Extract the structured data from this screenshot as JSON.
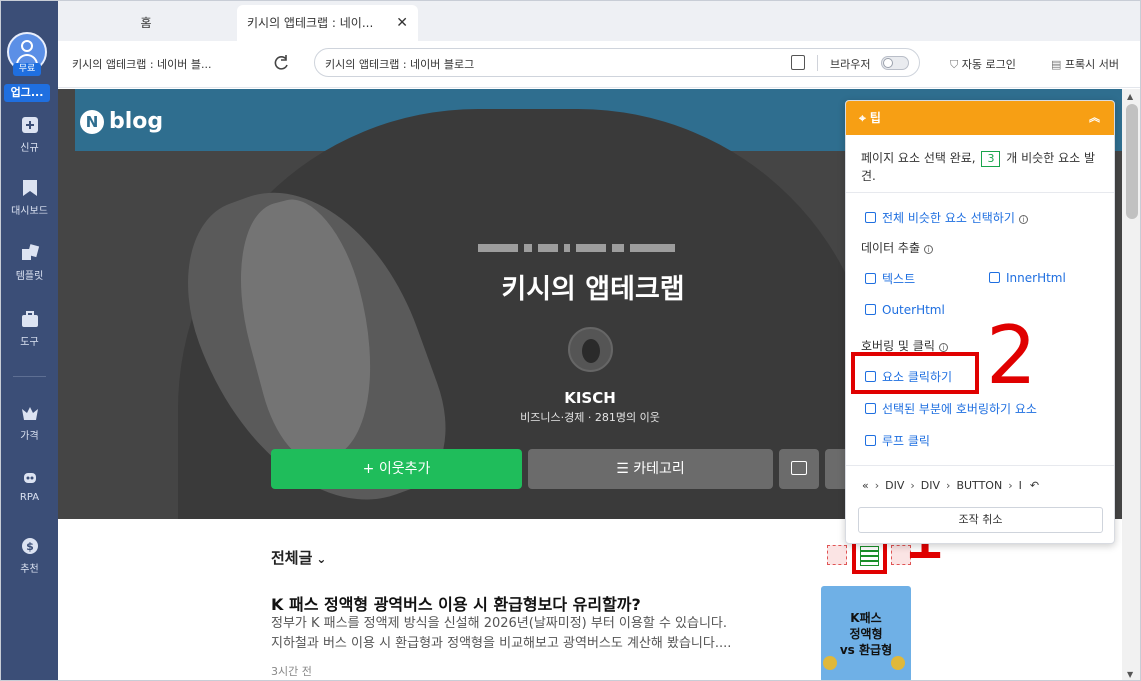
{
  "sidebar": {
    "free_badge": "무료",
    "upgrade_label": "업그...",
    "items": [
      {
        "label": "신규",
        "icon": "plus-square-icon"
      },
      {
        "label": "대시보드",
        "icon": "bookmark-icon"
      },
      {
        "label": "템플릿",
        "icon": "template-icon"
      },
      {
        "label": "도구",
        "icon": "toolbox-icon"
      },
      {
        "label": "가격",
        "icon": "crown-icon"
      },
      {
        "label": "RPA",
        "icon": "robot-icon"
      },
      {
        "label": "추천",
        "icon": "dollar-icon"
      }
    ]
  },
  "tabs": {
    "home": "홈",
    "active": "키시의 앱테크랩 : 네이...",
    "close": "✕"
  },
  "address": {
    "page_title": "키시의 앱테크랩 : 네이버 블...",
    "url": "키시의 앱테크랩 : 네이버 블로그",
    "browser_label": "브라우저",
    "autologin": "자동 로그인",
    "proxy": "프록시 서버"
  },
  "blog": {
    "logo_n": "N",
    "logo_text": "blog",
    "title": "키시의 앱테크랩",
    "nickname": "KISCH",
    "subtitle": "비즈니스·경제 · 281명의 이웃",
    "neighbor_btn": "+ 이웃추가",
    "category_btn": "☰ 카테고리",
    "section_title": "전체글",
    "post": {
      "title": "K 패스 정액형 광역버스 이용 시 환급형보다 유리할까?",
      "desc_1": "정부가 K 패스를 정액제 방식을 신설해 2026년(날짜미정) 부터 이용할 수 있습니다.",
      "desc_2": "지하철과 버스 이용 시 환급형과 정액형을 비교해보고 광역버스도 계산해 봤습니다....",
      "time": "3시간 전",
      "thumb_text": "K패스\n정액형\nvs 환급형"
    }
  },
  "tip_panel": {
    "header": "⌖ 팁",
    "msg_prefix": "페이지 요소 선택 완료,",
    "count": "3",
    "msg_suffix": "개 비슷한 요소 발견.",
    "select_all": "전체 비슷한 요소 선택하기",
    "data_extract": "데이터 추출",
    "text": "텍스트",
    "inner_html": "InnerHtml",
    "outer_html": "OuterHtml",
    "hover_click": "호버링 및 클릭",
    "click_element": "요소 클릭하기",
    "hover_selected": "선택된 부분에 호버링하기 요소",
    "loop_click": "루프 클릭",
    "breadcrumb": [
      "«",
      "›",
      "DIV",
      "›",
      "DIV",
      "›",
      "BUTTON",
      "›",
      "I"
    ],
    "cancel": "조작 취소"
  },
  "annotations": {
    "one": "1",
    "two": "2"
  },
  "colors": {
    "sidebar": "#3b4e77",
    "accent": "#1f6fe0",
    "tip_header": "#f79f14",
    "green": "#1fbd5b",
    "red_annot": "#e00000"
  }
}
